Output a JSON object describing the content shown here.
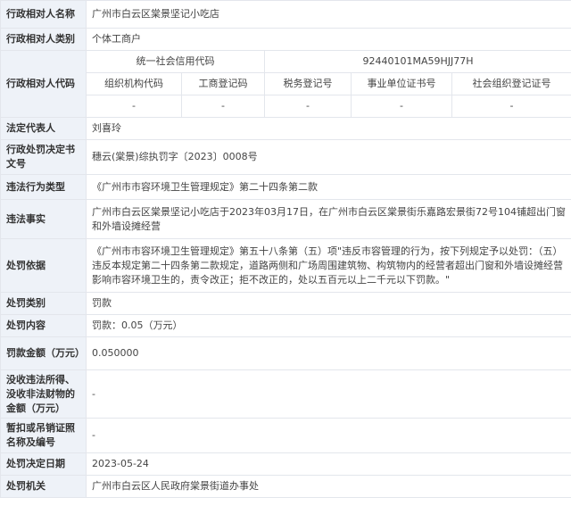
{
  "rows": {
    "target_name": {
      "label": "行政相对人名称",
      "value": "广州市白云区棠景坚记小吃店"
    },
    "target_type": {
      "label": "行政相对人类别",
      "value": "个体工商户"
    },
    "target_code": {
      "label": "行政相对人代码",
      "credit_code_label": "统一社会信用代码",
      "credit_code_value": "92440101MA59HJJ77H",
      "sub_headers": [
        "组织机构代码",
        "工商登记码",
        "税务登记号",
        "事业单位证书号",
        "社会组织登记证号"
      ],
      "sub_values": [
        "-",
        "-",
        "-",
        "-",
        "-"
      ]
    },
    "legal_rep": {
      "label": "法定代表人",
      "value": "刘喜玲"
    },
    "decision_no": {
      "label": "行政处罚决定书文号",
      "value": "穗云(棠景)综执罚字〔2023〕0008号"
    },
    "violation_type": {
      "label": "违法行为类型",
      "value": "《广州市市容环境卫生管理规定》第二十四条第二款"
    },
    "violation_facts": {
      "label": "违法事实",
      "value": "广州市白云区棠景坚记小吃店于2023年03月17日，在广州市白云区棠景街乐嘉路宏景街72号104铺超出门窗和外墙设摊经营"
    },
    "basis": {
      "label": "处罚依据",
      "value": "《广州市市容环境卫生管理规定》第五十八条第（五）项\"违反市容管理的行为，按下列规定予以处罚：（五）违反本规定第二十四条第二款规定，道路两侧和广场周围建筑物、构筑物内的经营者超出门窗和外墙设摊经营影响市容环境卫生的，责令改正；拒不改正的，处以五百元以上二千元以下罚款。\""
    },
    "penalty_type": {
      "label": "处罚类别",
      "value": "罚款"
    },
    "penalty_content": {
      "label": "处罚内容",
      "value": "罚款：0.05（万元）"
    },
    "fine_amount": {
      "label": "罚款金额（万元）",
      "value": "0.050000"
    },
    "confiscation": {
      "label": "没收违法所得、没收非法财物的金额（万元）",
      "value": "-"
    },
    "license": {
      "label": "暂扣或吊销证照名称及编号",
      "value": "-"
    },
    "decision_date": {
      "label": "处罚决定日期",
      "value": "2023-05-24"
    },
    "authority": {
      "label": "处罚机关",
      "value": "广州市白云区人民政府棠景街道办事处"
    }
  }
}
